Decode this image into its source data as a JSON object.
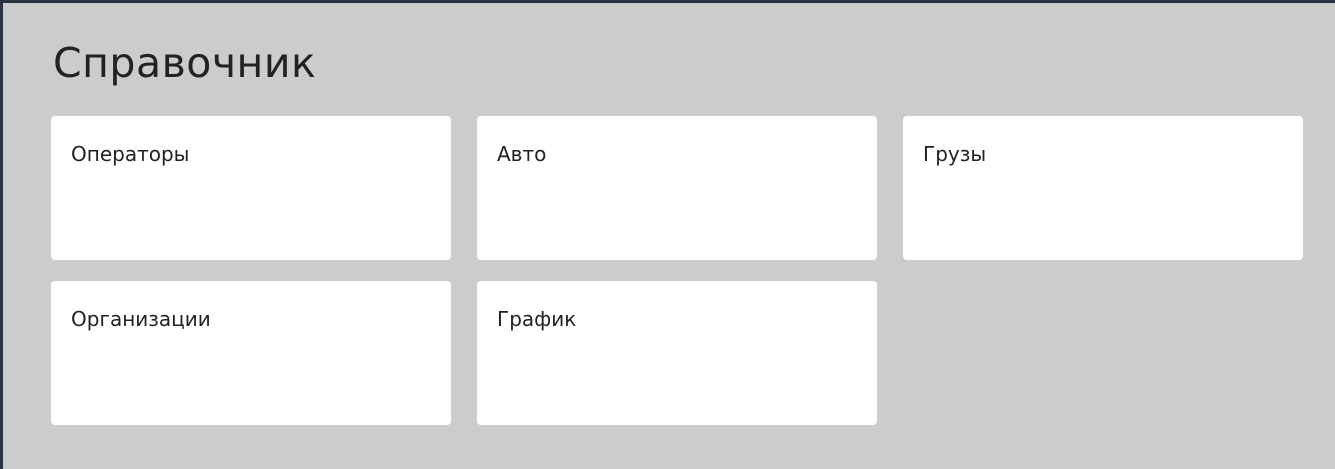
{
  "header": {
    "title": "Справочник"
  },
  "cards": [
    {
      "label": "Операторы"
    },
    {
      "label": "Авто"
    },
    {
      "label": "Грузы"
    },
    {
      "label": "Организации"
    },
    {
      "label": "График"
    }
  ],
  "colors": {
    "background": "#cccccc",
    "card": "#ffffff",
    "border": "#2a3442",
    "text": "#222222"
  }
}
